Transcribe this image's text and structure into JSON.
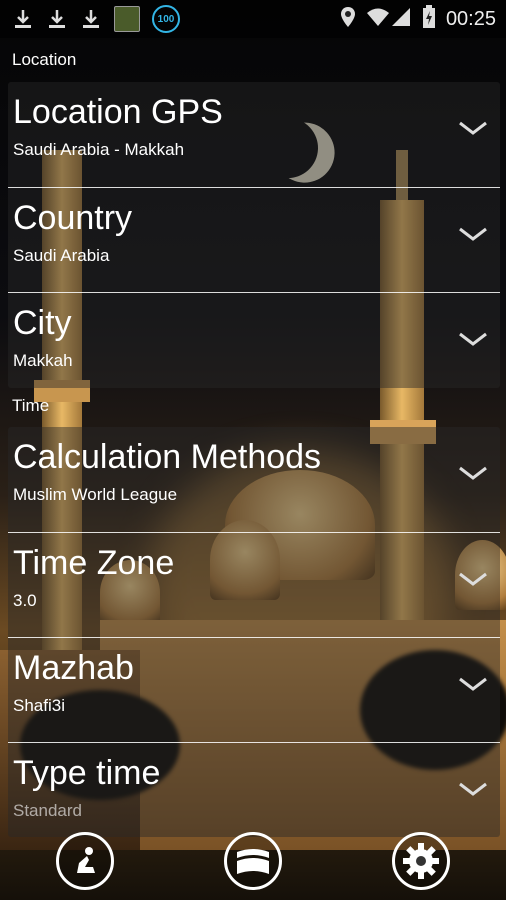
{
  "status_bar": {
    "icons": [
      "download-icon",
      "download-icon",
      "download-icon",
      "app-thumbnail-icon",
      "battery-badge-icon"
    ],
    "badge_text": "100",
    "right_icons": [
      "location-pin-icon",
      "wifi-signal-icon",
      "battery-charging-icon"
    ],
    "time": "00:25"
  },
  "sections": [
    {
      "title": "Location",
      "rows": [
        {
          "title": "Location GPS",
          "value": "Saudi Arabia - Makkah"
        },
        {
          "title": "Country",
          "value": "Saudi Arabia"
        },
        {
          "title": "City",
          "value": "Makkah"
        }
      ]
    },
    {
      "title": "Time",
      "rows": [
        {
          "title": "Calculation Methods",
          "value": "Muslim World League"
        },
        {
          "title": "Time Zone",
          "value": "3.0"
        },
        {
          "title": "Mazhab",
          "value": "Shafi3i"
        },
        {
          "title": "Type time",
          "value": "Standard"
        }
      ]
    }
  ],
  "bottom_nav": {
    "items": [
      "prayer-icon",
      "book-icon",
      "settings-gear-icon"
    ]
  },
  "colors": {
    "accent": "#33b5e5",
    "divider": "#ffffff"
  }
}
